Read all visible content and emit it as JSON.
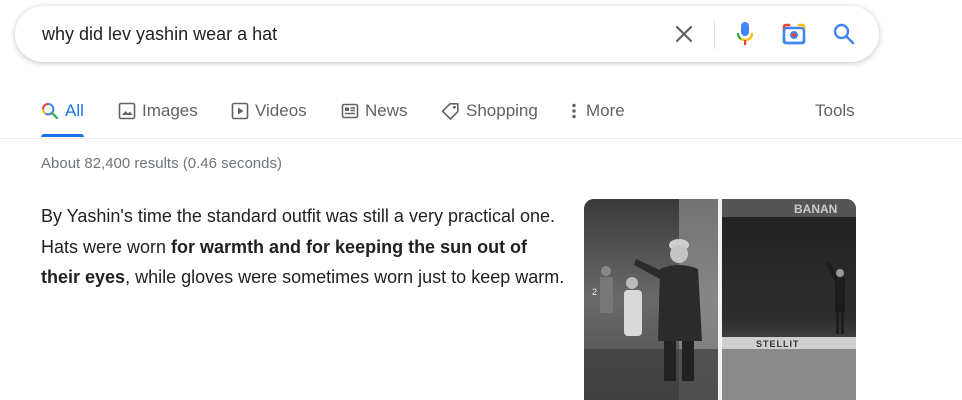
{
  "search": {
    "query": "why did lev yashin wear a hat",
    "icons": [
      "clear-icon",
      "mic-icon",
      "lens-icon",
      "search-icon"
    ]
  },
  "tabs": [
    {
      "label": "All",
      "icon": "search-icon",
      "active": true
    },
    {
      "label": "Images",
      "icon": "images-icon"
    },
    {
      "label": "Videos",
      "icon": "videos-icon"
    },
    {
      "label": "News",
      "icon": "news-icon"
    },
    {
      "label": "Shopping",
      "icon": "shopping-icon"
    },
    {
      "label": "More",
      "icon": "more-icon"
    }
  ],
  "tools_label": "Tools",
  "result_stats": "About 82,400 results (0.46 seconds)",
  "snippet": {
    "part1": "By Yashin's time the standard outfit was still a very practical one. Hats were worn ",
    "bold": "for warmth and for keeping the sun out of their eyes",
    "part2": ", while gloves were sometimes worn just to keep warm."
  },
  "image": {
    "stadium_sign_text": "BANAN",
    "ad_board_text": "STELLIT",
    "shirt_number": "2"
  },
  "colors": {
    "accent_blue": "#1a73e8",
    "text_dark": "#202124",
    "text_gray": "#5f6368",
    "stats_gray": "#70757a",
    "google_blue": "#4285f4",
    "google_red": "#ea4335",
    "google_yellow": "#fbbc04",
    "google_green": "#34a853"
  }
}
